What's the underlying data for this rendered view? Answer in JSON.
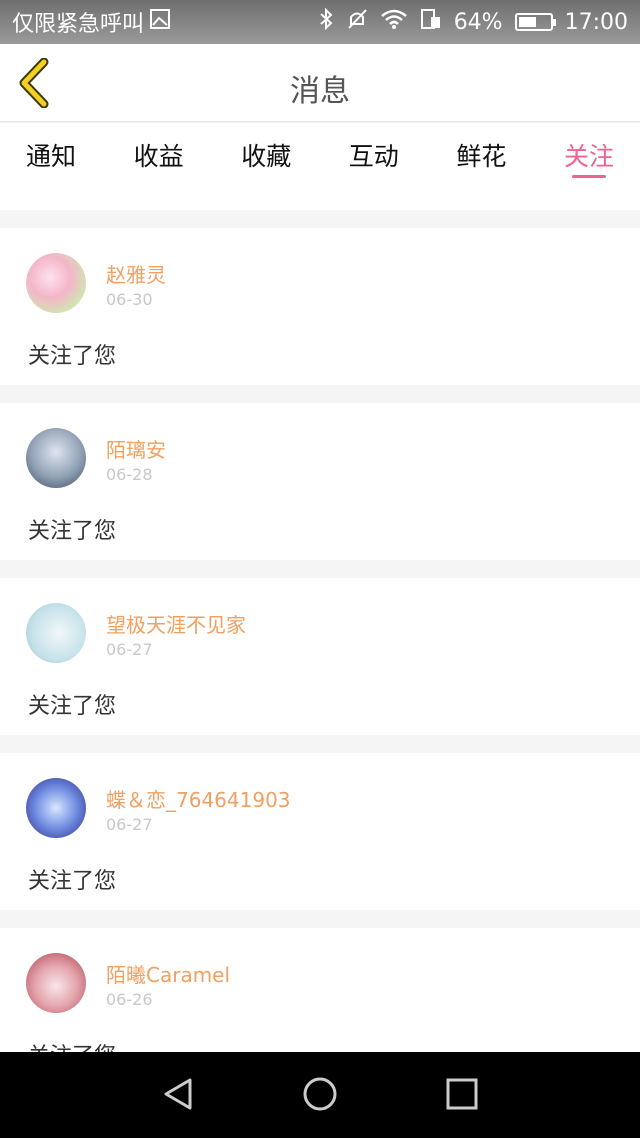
{
  "status_bar": {
    "carrier": "仅限紧急呼叫",
    "battery_percent": "64%",
    "battery_level": 0.64,
    "time": "17:00"
  },
  "header": {
    "title": "消息"
  },
  "tabs": [
    {
      "label": "通知",
      "active": false
    },
    {
      "label": "收益",
      "active": false
    },
    {
      "label": "收藏",
      "active": false
    },
    {
      "label": "互动",
      "active": false
    },
    {
      "label": "鲜花",
      "active": false
    },
    {
      "label": "关注",
      "active": true
    }
  ],
  "notifications": [
    {
      "user": "赵雅灵",
      "date": "06-30",
      "text": "关注了您"
    },
    {
      "user": "陌璃安",
      "date": "06-28",
      "text": "关注了您"
    },
    {
      "user": "望极天涯不见家",
      "date": "06-27",
      "text": "关注了您"
    },
    {
      "user": "蝶＆恋_764641903",
      "date": "06-27",
      "text": "关注了您"
    },
    {
      "user": "陌曦Caramel",
      "date": "06-26",
      "text": "关注了您"
    }
  ],
  "colors": {
    "accent_pink": "#f06292",
    "username_orange": "#f0a060",
    "back_arrow_yellow": "#f5d020"
  }
}
